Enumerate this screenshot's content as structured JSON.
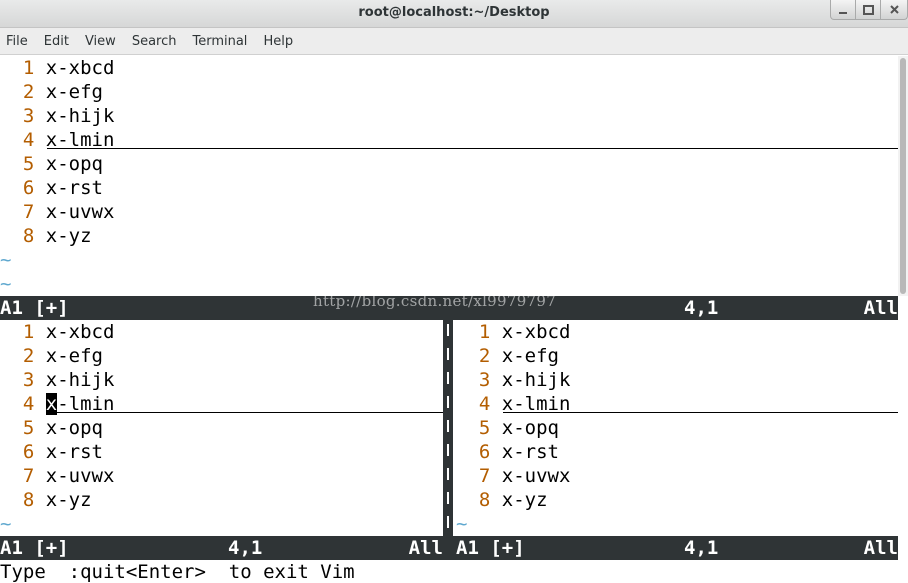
{
  "window": {
    "title": "root@localhost:~/Desktop"
  },
  "menubar": {
    "items": [
      "File",
      "Edit",
      "View",
      "Search",
      "Terminal",
      "Help"
    ]
  },
  "buffer": {
    "lines": [
      "x-xbcd",
      "x-efg",
      "x-hijk",
      "x-lmin",
      "x-opq",
      "x-rst",
      "x-uvwx",
      "x-yz"
    ],
    "line_numbers": [
      "1",
      "2",
      "3",
      "4",
      "5",
      "6",
      "7",
      "8"
    ],
    "tilde": "~"
  },
  "top_status": {
    "name": "A1 [+]",
    "position": "4,1",
    "percent": "All"
  },
  "bottom_left_status": {
    "name": "A1 [+]",
    "position": "4,1",
    "percent": "All"
  },
  "bottom_right_status": {
    "name": "A1 [+]",
    "position": "4,1",
    "percent": "All"
  },
  "command_line": "Type  :quit<Enter>  to exit Vim",
  "watermark": "http://blog.csdn.net/xl9979797",
  "colors": {
    "line_number": "#b35d00",
    "tilde": "#5fa8cf",
    "statusbar_bg": "#2f3436"
  }
}
